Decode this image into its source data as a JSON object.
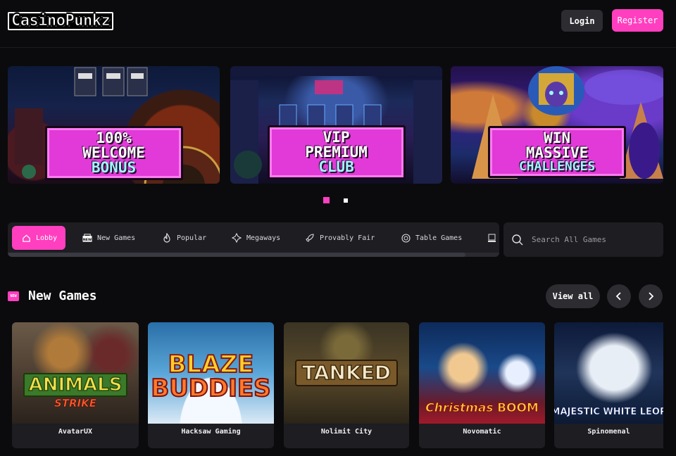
{
  "header": {
    "logo": "CasinoPunkz",
    "login_label": "Login",
    "register_label": "Register"
  },
  "banners": [
    {
      "line1": "100%",
      "line2": "WELCOME",
      "line3": "BONUS"
    },
    {
      "line1": "VIP",
      "line2": "PREMIUM",
      "line3": "CLUB"
    },
    {
      "line1": "WIN",
      "line2": "MASSIVE",
      "line3": "CHALLENGES"
    }
  ],
  "carousel": {
    "active_index": 0,
    "total": 2
  },
  "categories": [
    {
      "label": "Lobby",
      "icon": "home-icon",
      "active": true
    },
    {
      "label": "New Games",
      "icon": "new-badge-icon"
    },
    {
      "label": "Popular",
      "icon": "flame-icon"
    },
    {
      "label": "Megaways",
      "icon": "megaways-icon"
    },
    {
      "label": "Provably Fair",
      "icon": "rocket-icon"
    },
    {
      "label": "Table Games",
      "icon": "chip-icon"
    }
  ],
  "search": {
    "placeholder": "Search All Games"
  },
  "section": {
    "icon_text": "NEW",
    "title": "New Games",
    "view_all_label": "View all"
  },
  "games": [
    {
      "title": "ANIMALS",
      "subtitle": "STRIKE",
      "provider": "AvatarUX"
    },
    {
      "title": "BLAZE",
      "subtitle": "BUDDIES",
      "provider": "Hacksaw Gaming"
    },
    {
      "title": "TANKED",
      "subtitle": "",
      "provider": "Nolimit City"
    },
    {
      "title": "Christmas",
      "subtitle": "BOOM",
      "provider": "Novomatic"
    },
    {
      "title": "MAJESTIC WHITE LEOP",
      "subtitle": "",
      "provider": "Spinomenal"
    }
  ],
  "colors": {
    "accent": "#ff3fbf",
    "background": "#0b0b0d",
    "surface": "#1d1d22",
    "button": "#2c2c31"
  }
}
